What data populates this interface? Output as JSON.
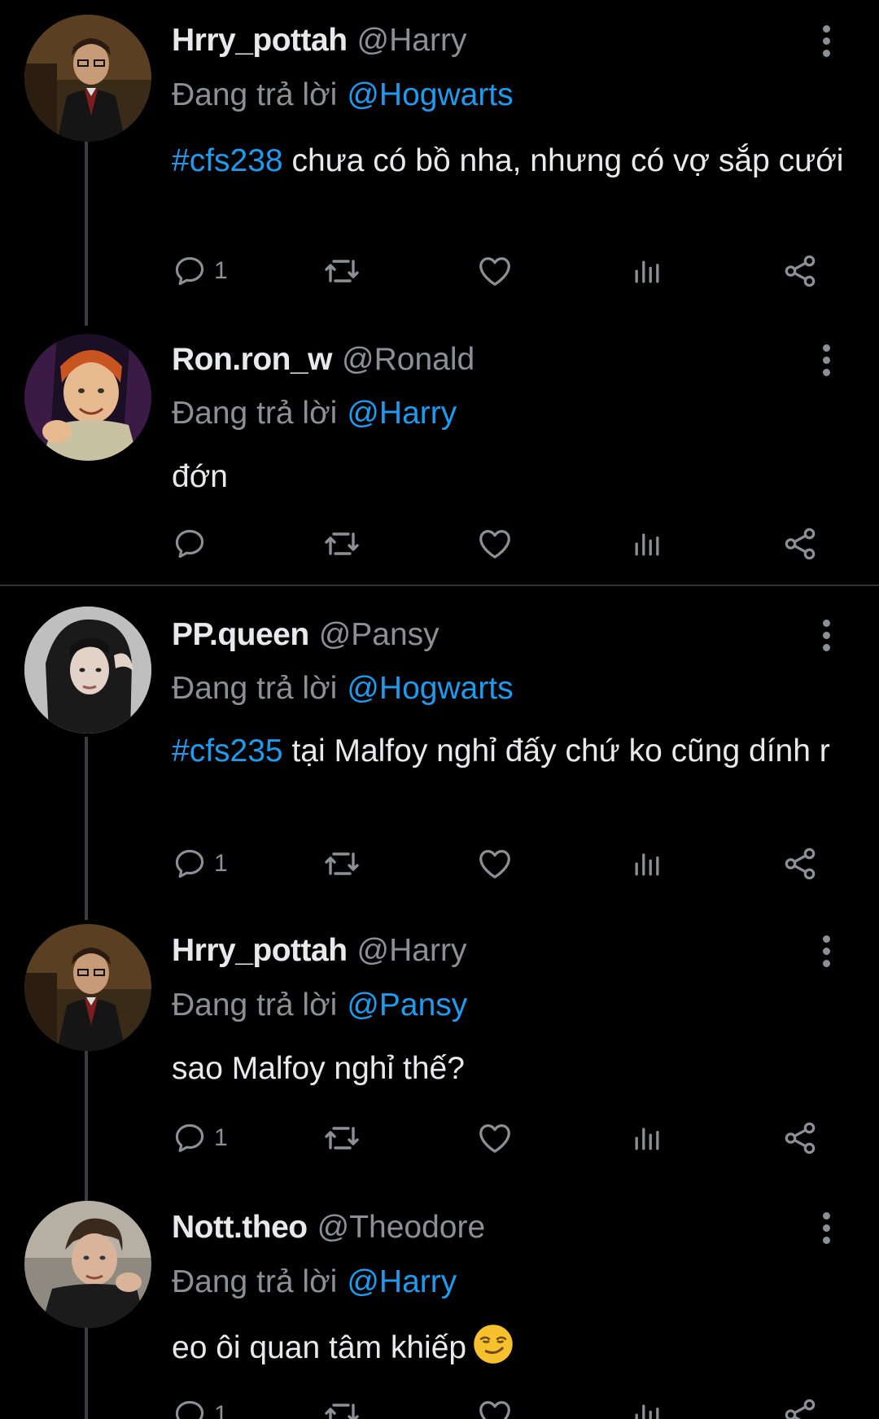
{
  "tweets": [
    {
      "display_name": "Hrry_pottah",
      "handle": "@Harry",
      "reply_prefix": "Đang trả lời",
      "reply_to": "@Hogwarts",
      "hashtag": "#cfs238",
      "text": " chưa có bồ nha, nhưng có vợ sắp cưới",
      "reply_count": "1"
    },
    {
      "display_name": "Ron.ron_w",
      "handle": "@Ronald",
      "reply_prefix": "Đang trả lời",
      "reply_to": "@Harry",
      "hashtag": "",
      "text": "đớn",
      "reply_count": ""
    },
    {
      "display_name": "PP.queen",
      "handle": "@Pansy",
      "reply_prefix": "Đang trả lời",
      "reply_to": "@Hogwarts",
      "hashtag": "#cfs235",
      "text": " tại Malfoy nghỉ đấy chứ ko cũng dính r",
      "reply_count": "1"
    },
    {
      "display_name": "Hrry_pottah",
      "handle": "@Harry",
      "reply_prefix": "Đang trả lời",
      "reply_to": "@Pansy",
      "hashtag": "",
      "text": "sao Malfoy nghỉ thế?",
      "reply_count": "1"
    },
    {
      "display_name": "Nott.theo",
      "handle": "@Theodore",
      "reply_prefix": "Đang trả lời",
      "reply_to": "@Harry",
      "hashtag": "",
      "text": "eo ôi quan tâm khiếp",
      "reply_count": "1"
    }
  ],
  "colors": {
    "background": "#000000",
    "text": "#e7e9ea",
    "muted": "#8b9096",
    "link": "#1d9bf0",
    "thread_line": "#3a3d41"
  },
  "icons": [
    "reply-icon",
    "retweet-icon",
    "like-icon",
    "views-icon",
    "share-icon",
    "more-options-icon",
    "smirking-face-emoji"
  ]
}
